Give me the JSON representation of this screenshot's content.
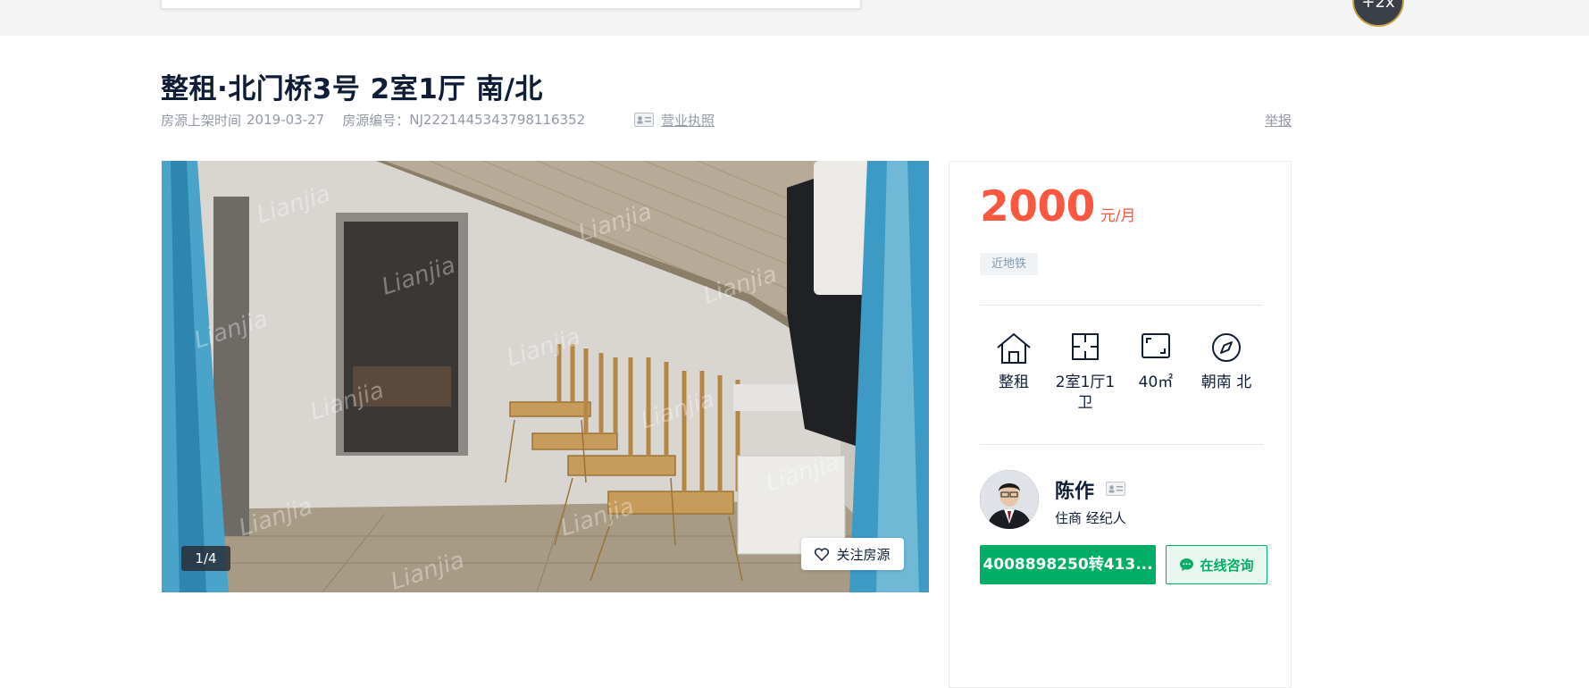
{
  "header": {
    "corner_badge": "+2x"
  },
  "listing": {
    "title": "整租·北门桥3号 2室1厅 南/北",
    "listed_label": "房源上架时间",
    "listed_date": "2019-03-27",
    "code_label": "房源编号：",
    "code": "NJ2221445343798116352",
    "license_link": "营业执照",
    "report_link": "举报"
  },
  "gallery": {
    "counter": "1/4",
    "follow_label": "关注房源",
    "watermark": "Lianjia"
  },
  "price": {
    "amount": "2000",
    "unit": "元/月",
    "tags": [
      "近地铁"
    ]
  },
  "features": [
    {
      "icon": "house-icon",
      "label": "整租"
    },
    {
      "icon": "floorplan-icon",
      "label": "2室1厅1卫"
    },
    {
      "icon": "area-icon",
      "label": "40㎡"
    },
    {
      "icon": "compass-icon",
      "label": "朝南 北"
    }
  ],
  "agent": {
    "name": "陈作",
    "title": "住商 经纪人",
    "phone_label": "4008898250转413...",
    "chat_label": "在线咨询"
  },
  "colors": {
    "price": "#fa5741",
    "accent_green": "#00ae66",
    "text_primary": "#101d37",
    "text_muted": "#9399a5"
  }
}
